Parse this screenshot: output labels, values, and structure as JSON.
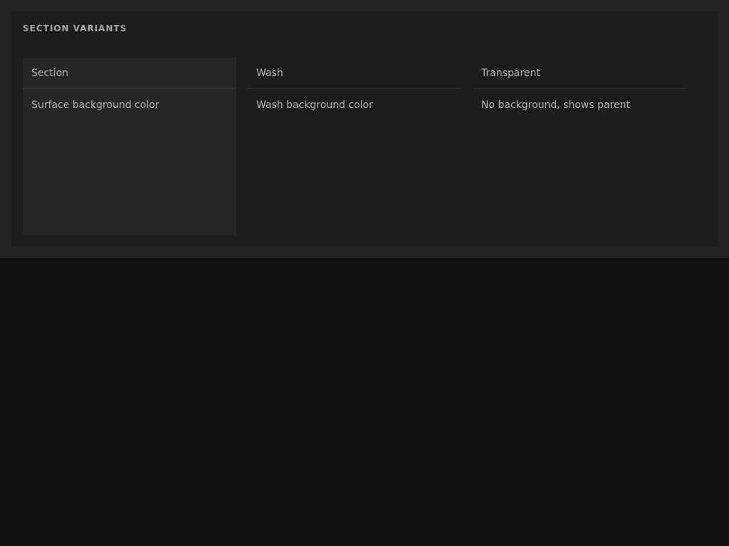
{
  "section_title": "SECTION VARIANTS",
  "variants": [
    {
      "label": "Section",
      "description": "Surface background color"
    },
    {
      "label": "Wash",
      "description": "Wash background color"
    },
    {
      "label": "Transparent",
      "description": "No background, shows parent"
    }
  ],
  "colors": {
    "page_background": "#121212",
    "outer_background": "#242424",
    "panel_background": "#1c1c1c",
    "surface_background": "#262626",
    "text": "#b4b4b4",
    "divider": "#3a3a3a"
  }
}
